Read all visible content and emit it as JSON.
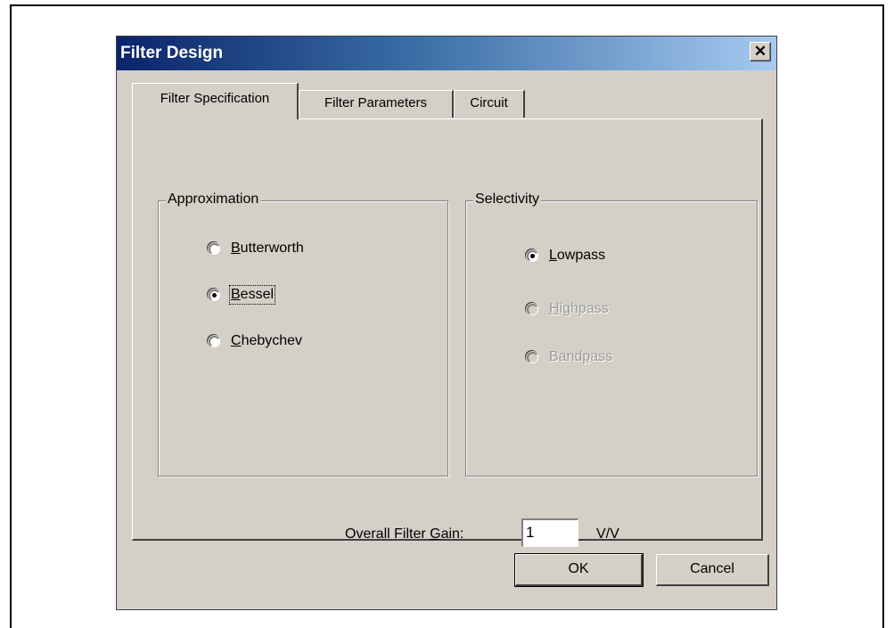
{
  "dialog": {
    "title": "Filter Design",
    "close_glyph": "✕"
  },
  "tabs": [
    {
      "label": "Filter Specification",
      "active": true
    },
    {
      "label": "Filter Parameters",
      "active": false
    },
    {
      "label": "Circuit",
      "active": false
    }
  ],
  "approximation": {
    "label": "Approximation",
    "options": [
      {
        "label": "Butterworth",
        "mnemonic": "B",
        "rest": "utterworth",
        "checked": false
      },
      {
        "label": "Bessel",
        "mnemonic": "B",
        "rest": "essel",
        "checked": true
      },
      {
        "label": "Chebychev",
        "mnemonic": "C",
        "rest": "hebychev",
        "checked": false
      }
    ]
  },
  "selectivity": {
    "label": "Selectivity",
    "options": [
      {
        "label": "Lowpass",
        "mnemonic": "L",
        "rest": "owpass",
        "checked": true,
        "enabled": true
      },
      {
        "label": "Highpass",
        "mnemonic": "H",
        "rest": "ighpass",
        "checked": false,
        "enabled": false
      },
      {
        "label": "Bandpass",
        "pre": "Band",
        "mnemonic": "p",
        "rest": "ass",
        "checked": false,
        "enabled": false
      }
    ]
  },
  "gain": {
    "label_pre": "Overall Filter ",
    "label_mnemonic": "G",
    "label_post": "ain:",
    "value": "1",
    "unit": "V/V"
  },
  "buttons": {
    "ok": "OK",
    "cancel": "Cancel"
  }
}
